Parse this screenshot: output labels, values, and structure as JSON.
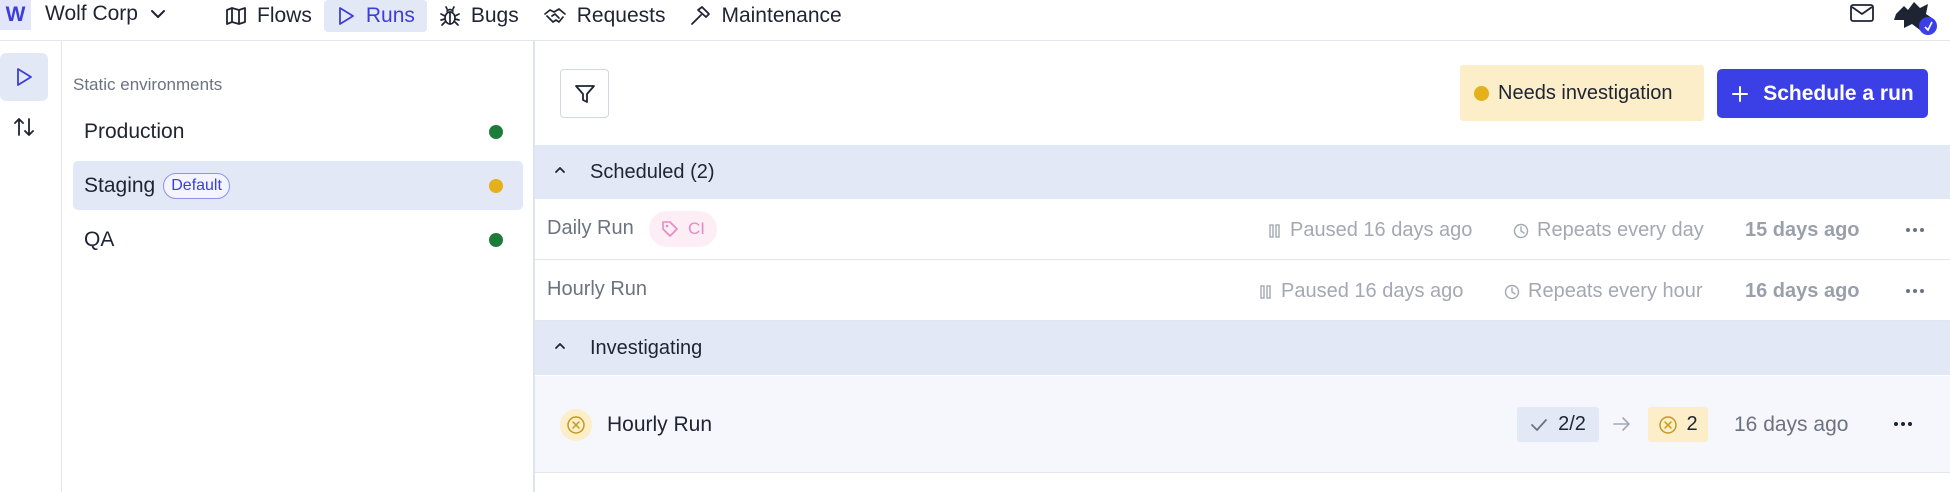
{
  "header": {
    "logo_letter": "W",
    "org_name": "Wolf Corp",
    "nav": [
      {
        "label": "Flows",
        "icon": "map-icon"
      },
      {
        "label": "Runs",
        "icon": "play-icon",
        "active": true
      },
      {
        "label": "Bugs",
        "icon": "bug-icon"
      },
      {
        "label": "Requests",
        "icon": "handshake-icon"
      },
      {
        "label": "Maintenance",
        "icon": "hammer-icon"
      }
    ]
  },
  "environments": {
    "heading": "Static environments",
    "items": [
      {
        "name": "Production",
        "status_color": "#1e7c3a"
      },
      {
        "name": "Staging",
        "badge": "Default",
        "status_color": "#e4b11a",
        "selected": true
      },
      {
        "name": "QA",
        "status_color": "#1e7c3a"
      }
    ]
  },
  "toolbar": {
    "needs_investigation": "Needs investigation",
    "schedule_button": "Schedule a run"
  },
  "scheduled": {
    "title": "Scheduled (2)",
    "runs": [
      {
        "name": "Daily Run",
        "tag": "CI",
        "paused": "Paused 16 days ago",
        "repeats": "Repeats every day",
        "last": "15 days ago"
      },
      {
        "name": "Hourly Run",
        "paused": "Paused 16 days ago",
        "repeats": "Repeats every hour",
        "last": "16 days ago"
      }
    ]
  },
  "investigating": {
    "title": "Investigating",
    "runs": [
      {
        "name": "Hourly Run",
        "passed": "2/2",
        "failed": "2",
        "time": "16 days ago"
      }
    ]
  },
  "colors": {
    "accent": "#3b3fe6",
    "selected_bg": "#e3e8f7",
    "warning_bg": "#fbeec8",
    "success": "#1e7c3a",
    "warning": "#e4b11a"
  }
}
